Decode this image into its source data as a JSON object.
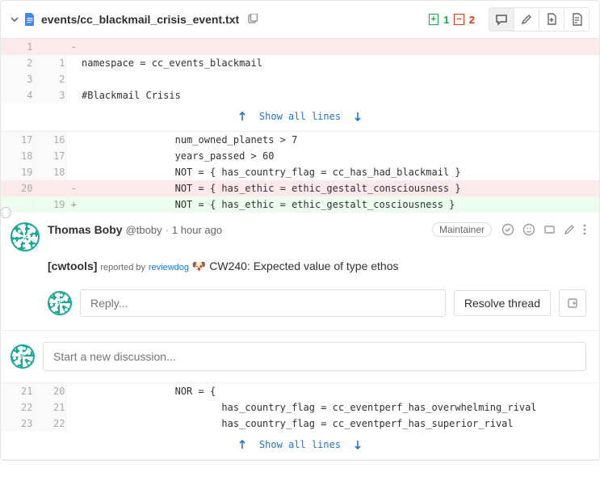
{
  "file": {
    "path": "events/cc_blackmail_crisis_event.txt",
    "added_count": "1",
    "removed_count": "2"
  },
  "hunks": {
    "top": [
      {
        "old": "1",
        "new": "",
        "sign": "-",
        "type": "removed",
        "code": ""
      },
      {
        "old": "2",
        "new": "1",
        "sign": "",
        "type": "ctx",
        "code": "namespace = cc_events_blackmail"
      },
      {
        "old": "3",
        "new": "2",
        "sign": "",
        "type": "ctx",
        "code": ""
      },
      {
        "old": "4",
        "new": "3",
        "sign": "",
        "type": "ctx",
        "code": "#Blackmail Crisis"
      }
    ],
    "mid": [
      {
        "old": "17",
        "new": "16",
        "sign": "",
        "type": "ctx",
        "code": "                num_owned_planets > 7"
      },
      {
        "old": "18",
        "new": "17",
        "sign": "",
        "type": "ctx",
        "code": "                years_passed > 60"
      },
      {
        "old": "19",
        "new": "18",
        "sign": "",
        "type": "ctx",
        "code": "                NOT = { has_country_flag = cc_has_had_blackmail }"
      },
      {
        "old": "20",
        "new": "",
        "sign": "-",
        "type": "removed",
        "code": "                NOT = { has_ethic = ethic_gestalt_consciousness }"
      },
      {
        "old": "",
        "new": "19",
        "sign": "+",
        "type": "added",
        "code": "                NOT = { has_ethic = ethic_gestalt_cosciousness }"
      }
    ],
    "bottom": [
      {
        "old": "21",
        "new": "20",
        "sign": "",
        "type": "ctx",
        "code": "                NOR = {"
      },
      {
        "old": "22",
        "new": "21",
        "sign": "",
        "type": "ctx",
        "code": "                        has_country_flag = cc_eventperf_has_overwhelming_rival"
      },
      {
        "old": "23",
        "new": "22",
        "sign": "",
        "type": "ctx",
        "code": "                        has_country_flag = cc_eventperf_has_superior_rival"
      }
    ]
  },
  "expand_label": "Show all lines",
  "discussion": {
    "author_name": "Thomas Boby",
    "author_handle": "@tboby",
    "time": "1 hour ago",
    "role": "Maintainer",
    "body_tag": "[cwtools]",
    "body_reported": "reported by",
    "body_link": "reviewdog",
    "body_msg": "CW240: Expected value of type ethos"
  },
  "reply_placeholder": "Reply...",
  "resolve_label": "Resolve thread",
  "new_discussion_placeholder": "Start a new discussion..."
}
